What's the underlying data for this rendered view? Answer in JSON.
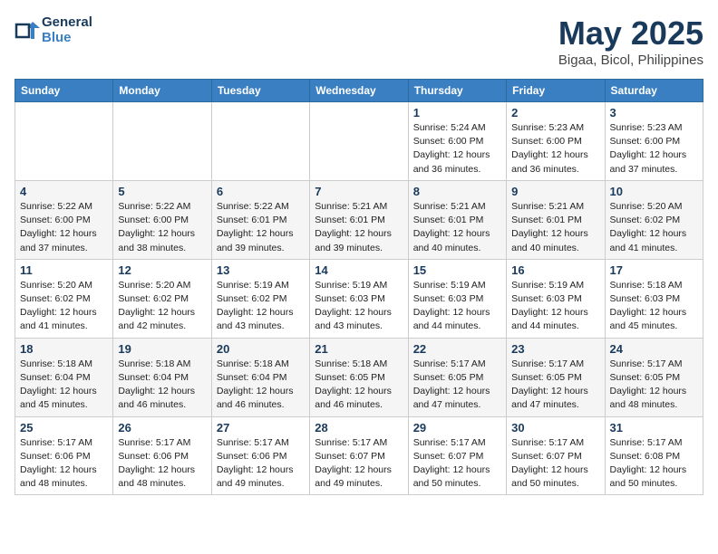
{
  "header": {
    "logo_line1": "General",
    "logo_line2": "Blue",
    "month": "May 2025",
    "location": "Bigaa, Bicol, Philippines"
  },
  "weekdays": [
    "Sunday",
    "Monday",
    "Tuesday",
    "Wednesday",
    "Thursday",
    "Friday",
    "Saturday"
  ],
  "weeks": [
    [
      {
        "day": "",
        "info": ""
      },
      {
        "day": "",
        "info": ""
      },
      {
        "day": "",
        "info": ""
      },
      {
        "day": "",
        "info": ""
      },
      {
        "day": "1",
        "info": "Sunrise: 5:24 AM\nSunset: 6:00 PM\nDaylight: 12 hours\nand 36 minutes."
      },
      {
        "day": "2",
        "info": "Sunrise: 5:23 AM\nSunset: 6:00 PM\nDaylight: 12 hours\nand 36 minutes."
      },
      {
        "day": "3",
        "info": "Sunrise: 5:23 AM\nSunset: 6:00 PM\nDaylight: 12 hours\nand 37 minutes."
      }
    ],
    [
      {
        "day": "4",
        "info": "Sunrise: 5:22 AM\nSunset: 6:00 PM\nDaylight: 12 hours\nand 37 minutes."
      },
      {
        "day": "5",
        "info": "Sunrise: 5:22 AM\nSunset: 6:00 PM\nDaylight: 12 hours\nand 38 minutes."
      },
      {
        "day": "6",
        "info": "Sunrise: 5:22 AM\nSunset: 6:01 PM\nDaylight: 12 hours\nand 39 minutes."
      },
      {
        "day": "7",
        "info": "Sunrise: 5:21 AM\nSunset: 6:01 PM\nDaylight: 12 hours\nand 39 minutes."
      },
      {
        "day": "8",
        "info": "Sunrise: 5:21 AM\nSunset: 6:01 PM\nDaylight: 12 hours\nand 40 minutes."
      },
      {
        "day": "9",
        "info": "Sunrise: 5:21 AM\nSunset: 6:01 PM\nDaylight: 12 hours\nand 40 minutes."
      },
      {
        "day": "10",
        "info": "Sunrise: 5:20 AM\nSunset: 6:02 PM\nDaylight: 12 hours\nand 41 minutes."
      }
    ],
    [
      {
        "day": "11",
        "info": "Sunrise: 5:20 AM\nSunset: 6:02 PM\nDaylight: 12 hours\nand 41 minutes."
      },
      {
        "day": "12",
        "info": "Sunrise: 5:20 AM\nSunset: 6:02 PM\nDaylight: 12 hours\nand 42 minutes."
      },
      {
        "day": "13",
        "info": "Sunrise: 5:19 AM\nSunset: 6:02 PM\nDaylight: 12 hours\nand 43 minutes."
      },
      {
        "day": "14",
        "info": "Sunrise: 5:19 AM\nSunset: 6:03 PM\nDaylight: 12 hours\nand 43 minutes."
      },
      {
        "day": "15",
        "info": "Sunrise: 5:19 AM\nSunset: 6:03 PM\nDaylight: 12 hours\nand 44 minutes."
      },
      {
        "day": "16",
        "info": "Sunrise: 5:19 AM\nSunset: 6:03 PM\nDaylight: 12 hours\nand 44 minutes."
      },
      {
        "day": "17",
        "info": "Sunrise: 5:18 AM\nSunset: 6:03 PM\nDaylight: 12 hours\nand 45 minutes."
      }
    ],
    [
      {
        "day": "18",
        "info": "Sunrise: 5:18 AM\nSunset: 6:04 PM\nDaylight: 12 hours\nand 45 minutes."
      },
      {
        "day": "19",
        "info": "Sunrise: 5:18 AM\nSunset: 6:04 PM\nDaylight: 12 hours\nand 46 minutes."
      },
      {
        "day": "20",
        "info": "Sunrise: 5:18 AM\nSunset: 6:04 PM\nDaylight: 12 hours\nand 46 minutes."
      },
      {
        "day": "21",
        "info": "Sunrise: 5:18 AM\nSunset: 6:05 PM\nDaylight: 12 hours\nand 46 minutes."
      },
      {
        "day": "22",
        "info": "Sunrise: 5:17 AM\nSunset: 6:05 PM\nDaylight: 12 hours\nand 47 minutes."
      },
      {
        "day": "23",
        "info": "Sunrise: 5:17 AM\nSunset: 6:05 PM\nDaylight: 12 hours\nand 47 minutes."
      },
      {
        "day": "24",
        "info": "Sunrise: 5:17 AM\nSunset: 6:05 PM\nDaylight: 12 hours\nand 48 minutes."
      }
    ],
    [
      {
        "day": "25",
        "info": "Sunrise: 5:17 AM\nSunset: 6:06 PM\nDaylight: 12 hours\nand 48 minutes."
      },
      {
        "day": "26",
        "info": "Sunrise: 5:17 AM\nSunset: 6:06 PM\nDaylight: 12 hours\nand 48 minutes."
      },
      {
        "day": "27",
        "info": "Sunrise: 5:17 AM\nSunset: 6:06 PM\nDaylight: 12 hours\nand 49 minutes."
      },
      {
        "day": "28",
        "info": "Sunrise: 5:17 AM\nSunset: 6:07 PM\nDaylight: 12 hours\nand 49 minutes."
      },
      {
        "day": "29",
        "info": "Sunrise: 5:17 AM\nSunset: 6:07 PM\nDaylight: 12 hours\nand 50 minutes."
      },
      {
        "day": "30",
        "info": "Sunrise: 5:17 AM\nSunset: 6:07 PM\nDaylight: 12 hours\nand 50 minutes."
      },
      {
        "day": "31",
        "info": "Sunrise: 5:17 AM\nSunset: 6:08 PM\nDaylight: 12 hours\nand 50 minutes."
      }
    ]
  ]
}
